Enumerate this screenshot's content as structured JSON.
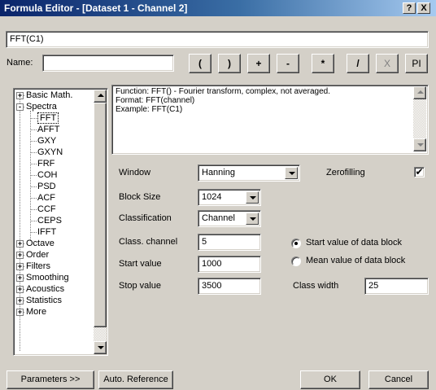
{
  "window": {
    "title": "Formula Editor - [Dataset 1 - Channel 2]",
    "help_glyph": "?",
    "close_glyph": "X"
  },
  "formula": {
    "value": "FFT(C1)"
  },
  "name": {
    "label": "Name:",
    "value": ""
  },
  "operators": [
    "(",
    ")",
    "+",
    "-",
    "*",
    "/",
    "X",
    "PI"
  ],
  "tree": {
    "items": [
      {
        "label": "Basic Math.",
        "expander": "+",
        "level": 0
      },
      {
        "label": "Spectra",
        "expander": "-",
        "level": 0
      },
      {
        "label": "FFT",
        "level": 1,
        "selected": true
      },
      {
        "label": "AFFT",
        "level": 1
      },
      {
        "label": "GXY",
        "level": 1
      },
      {
        "label": "GXYN",
        "level": 1
      },
      {
        "label": "FRF",
        "level": 1
      },
      {
        "label": "COH",
        "level": 1
      },
      {
        "label": "PSD",
        "level": 1
      },
      {
        "label": "ACF",
        "level": 1
      },
      {
        "label": "CCF",
        "level": 1
      },
      {
        "label": "CEPS",
        "level": 1
      },
      {
        "label": "IFFT",
        "level": 1
      },
      {
        "label": "Octave",
        "expander": "+",
        "level": 0
      },
      {
        "label": "Order",
        "expander": "+",
        "level": 0
      },
      {
        "label": "Filters",
        "expander": "+",
        "level": 0
      },
      {
        "label": "Smoothing",
        "expander": "+",
        "level": 0
      },
      {
        "label": "Acoustics",
        "expander": "+",
        "level": 0
      },
      {
        "label": "Statistics",
        "expander": "+",
        "level": 0
      },
      {
        "label": "More",
        "expander": "+",
        "level": 0
      }
    ]
  },
  "info": {
    "line1": "Function:  FFT() - Fourier transform, complex, not averaged.",
    "line2": "Format:    FFT(channel)",
    "line3": "Example:  FFT(C1)"
  },
  "params": {
    "window_label": "Window",
    "window_value": "Hanning",
    "zerofilling_label": "Zerofilling",
    "zerofilling_checked": true,
    "zerofilling_mark": "✔",
    "blocksize_label": "Block Size",
    "blocksize_value": "1024",
    "classification_label": "Classification",
    "classification_value": "Channel",
    "class_channel_label": "Class. channel",
    "class_channel_value": "5",
    "start_label": "Start value",
    "start_value": "1000",
    "stop_label": "Stop value",
    "stop_value": "3500",
    "radio_start_label": "Start value of data block",
    "radio_mean_label": "Mean value of data block",
    "radio_selected": "start",
    "class_width_label": "Class width",
    "class_width_value": "25"
  },
  "buttons": {
    "parameters": "Parameters >>",
    "auto_reference": "Auto. Reference",
    "ok": "OK",
    "cancel": "Cancel"
  }
}
